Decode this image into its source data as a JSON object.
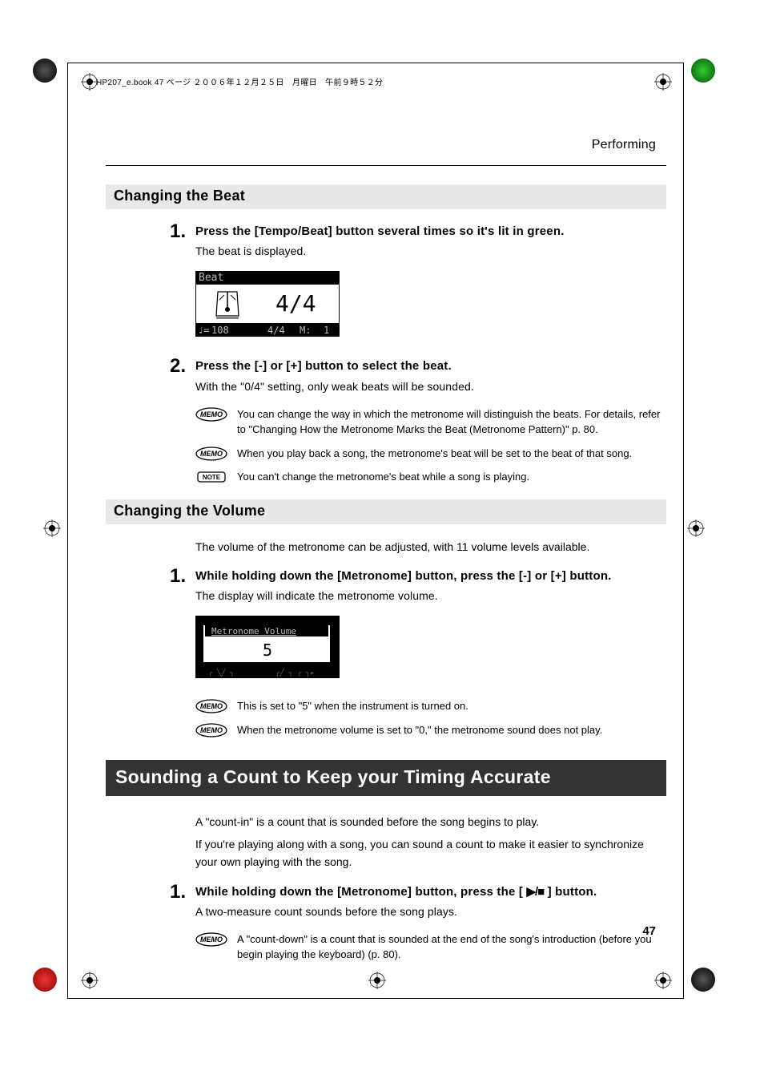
{
  "book_info": "HP207_e.book  47 ページ  ２００６年１２月２５日　月曜日　午前９時５２分",
  "section_title": "Performing",
  "page_number": "47",
  "changing_beat": {
    "heading": "Changing the Beat",
    "step1_num": "1.",
    "step1_head": "Press the [Tempo/Beat] button several times so it's lit in green.",
    "step1_body": "The beat is displayed.",
    "step2_num": "2.",
    "step2_head": "Press the [-] or [+] button to select the beat.",
    "step2_body": "With the \"0/4\" setting, only weak beats will be sounded.",
    "memo1": "You can change the way in which the metronome will distinguish the beats. For details, refer to \"Changing How the Metronome Marks the Beat (Metronome Pattern)\" p. 80.",
    "memo2": "When you play back a song, the metronome's beat will be set to the beat of that song.",
    "note1": "You can't change the metronome's beat while a song is playing.",
    "lcd": {
      "title": "Beat",
      "main": "4/4",
      "tempo": "108",
      "beat_sm": "4/4",
      "measure_label": "M:",
      "measure": "1"
    }
  },
  "changing_volume": {
    "heading": "Changing the Volume",
    "intro": "The volume of the metronome can be adjusted, with 11 volume levels available.",
    "step1_num": "1.",
    "step1_head": "While holding down the [Metronome] button, press the [-] or [+] button.",
    "step1_body": "The display will indicate the metronome volume.",
    "memo1": "This is set to \"5\" when the instrument is turned on.",
    "memo2": "When the metronome volume is set to \"0,\" the metronome sound does not play.",
    "lcd": {
      "title": "Metronome Volume",
      "main": "5"
    }
  },
  "sounding_count": {
    "heading": "Sounding a Count to Keep your Timing Accurate",
    "intro1": "A \"count-in\" is a count that is sounded before the song begins to play.",
    "intro2": "If you're playing along with a song, you can sound a count to make it easier to synchronize your own playing with the song.",
    "step1_num": "1.",
    "step1_head_a": "While holding down the [Metronome] button, press the [ ",
    "step1_head_b": " ] button.",
    "step1_body": "A two-measure count sounds before the song plays.",
    "memo1": "A \"count-down\" is a count that is sounded at the end of the song's introduction (before you begin playing the keyboard) (p. 80)."
  }
}
